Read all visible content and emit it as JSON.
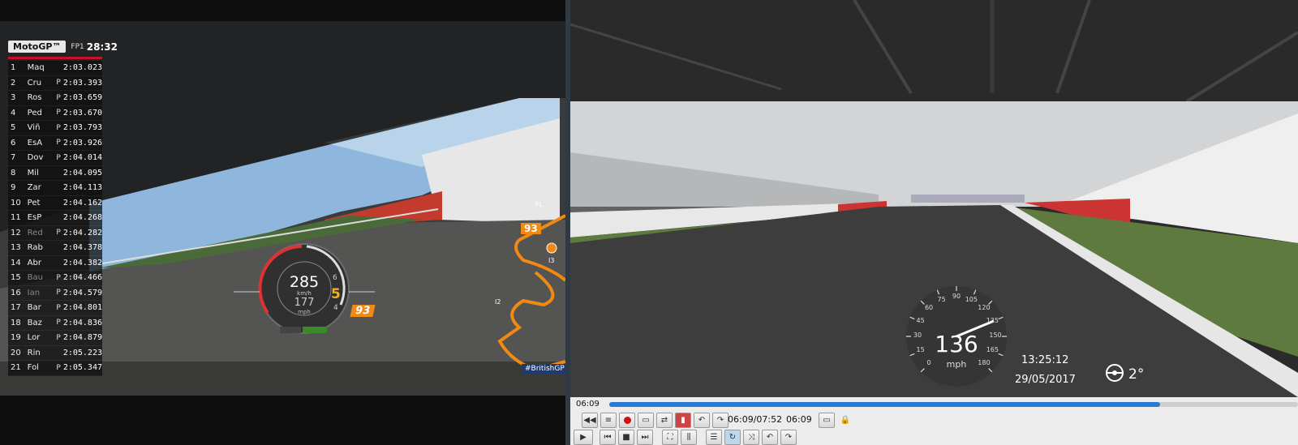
{
  "left_overlay": {
    "series_logo": "MotoGP™",
    "session": "FP1",
    "session_clock": "28:32",
    "timing": [
      {
        "pos": "1",
        "rider": "Maq",
        "pit": "",
        "lap": "2:03.023",
        "dim": false
      },
      {
        "pos": "2",
        "rider": "Cru",
        "pit": "P",
        "lap": "2:03.393",
        "dim": false
      },
      {
        "pos": "3",
        "rider": "Ros",
        "pit": "P",
        "lap": "2:03.659",
        "dim": false
      },
      {
        "pos": "4",
        "rider": "Ped",
        "pit": "P",
        "lap": "2:03.670",
        "dim": false
      },
      {
        "pos": "5",
        "rider": "Viñ",
        "pit": "P",
        "lap": "2:03.793",
        "dim": false
      },
      {
        "pos": "6",
        "rider": "EsA",
        "pit": "P",
        "lap": "2:03.926",
        "dim": false
      },
      {
        "pos": "7",
        "rider": "Dov",
        "pit": "P",
        "lap": "2:04.014",
        "dim": false
      },
      {
        "pos": "8",
        "rider": "Mil",
        "pit": "",
        "lap": "2:04.095",
        "dim": false
      },
      {
        "pos": "9",
        "rider": "Zar",
        "pit": "",
        "lap": "2:04.113",
        "dim": false
      },
      {
        "pos": "10",
        "rider": "Pet",
        "pit": "",
        "lap": "2:04.162",
        "dim": false
      },
      {
        "pos": "11",
        "rider": "EsP",
        "pit": "",
        "lap": "2:04.268",
        "dim": false
      },
      {
        "pos": "12",
        "rider": "Red",
        "pit": "P",
        "lap": "2:04.282",
        "dim": true
      },
      {
        "pos": "13",
        "rider": "Rab",
        "pit": "",
        "lap": "2:04.378",
        "dim": false
      },
      {
        "pos": "14",
        "rider": "Abr",
        "pit": "",
        "lap": "2:04.382",
        "dim": false
      },
      {
        "pos": "15",
        "rider": "Bau",
        "pit": "P",
        "lap": "2:04.466",
        "dim": true
      },
      {
        "pos": "16",
        "rider": "Ian",
        "pit": "P",
        "lap": "2:04.579",
        "dim": true
      },
      {
        "pos": "17",
        "rider": "Bar",
        "pit": "P",
        "lap": "2:04.801",
        "dim": false
      },
      {
        "pos": "18",
        "rider": "Baz",
        "pit": "P",
        "lap": "2:04.836",
        "dim": false
      },
      {
        "pos": "19",
        "rider": "Lor",
        "pit": "P",
        "lap": "2:04.879",
        "dim": false
      },
      {
        "pos": "20",
        "rider": "Rin",
        "pit": "",
        "lap": "2:05.223",
        "dim": false
      },
      {
        "pos": "21",
        "rider": "Fol",
        "pit": "P",
        "lap": "2:05.347",
        "dim": false
      }
    ],
    "gauge": {
      "kmh": "285",
      "kmh_unit": "km/h",
      "mph": "177",
      "mph_unit": "mph",
      "gear": "5",
      "gear_above": "6",
      "gear_below": "4",
      "rider_number": "93"
    },
    "map": {
      "rider_number": "93",
      "label_fl": "FL",
      "label_i3": "I3",
      "label_i2": "I2"
    },
    "hashtag": "#BritishGP",
    "accent_orange": "#f08a14"
  },
  "right_overlay": {
    "speed": "136",
    "speed_unit": "mph",
    "dial_ticks": [
      "0",
      "15",
      "30",
      "45",
      "60",
      "75",
      "90",
      "105",
      "120",
      "135",
      "150",
      "165",
      "180"
    ],
    "time": "13:25:12",
    "date": "29/05/2017",
    "lean_angle": "2°"
  },
  "player": {
    "elapsed": "06:09",
    "position_label": "06:09/07:52",
    "current_time": "06:09",
    "progress_fraction": 0.8,
    "accent": "#2a7bd6"
  }
}
